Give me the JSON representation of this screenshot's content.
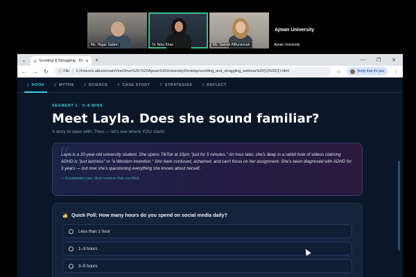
{
  "meeting": {
    "participants": [
      {
        "name": "Ms. Hagar Sallam"
      },
      {
        "name": "Dr. Nida Khan"
      },
      {
        "name": "Ms. Samah AlBuniemah"
      }
    ],
    "org_title": "Ajman University",
    "org_label": "Ajman University"
  },
  "browser": {
    "tab_title": "Scrolling & Struggling - Dr. Ni...",
    "file_label": "File",
    "url": "C:/Users/s.albuniemah/OneDrive%20-%20Ajman%20University/Desktop/scrolling_and_struggling_webinar%20(1)%20(1).html",
    "verify_label": "Verify that it's you"
  },
  "page": {
    "nav": [
      {
        "num": "1",
        "label": "HOOK",
        "active": true
      },
      {
        "num": "2",
        "label": "MYTHS"
      },
      {
        "num": "3",
        "label": "SCIENCE"
      },
      {
        "num": "4",
        "label": "CASE STUDY"
      },
      {
        "num": "5",
        "label": "STRATEGIES"
      },
      {
        "num": "6",
        "label": "REFLECT"
      }
    ],
    "segment": "SEGMENT 1 · 0–8 MINS",
    "title": "Meet Layla. Does she sound familiar?",
    "subtitle": "A story to open with. Then — let's see where YOU stand.",
    "story": {
      "text": "Layla is a 20-year-old university student. She opens TikTok at 10pm \"just for 5 minutes.\" An hour later, she's deep in a rabbit hole of videos claiming ADHD is \"just laziness\" or \"a Western invention.\" She feels confused, ashamed, and can't focus on her assignment. She's been diagnosed with ADHD for 3 years — but now she's questioning everything she knows about herself.",
      "caption": "— A composite case. More common than you think."
    },
    "poll": {
      "question": "Quick Poll: How many hours do you spend on social media daily?",
      "options": [
        "Less than 1 hour",
        "1–3 hours",
        "3–5 hours"
      ]
    }
  }
}
